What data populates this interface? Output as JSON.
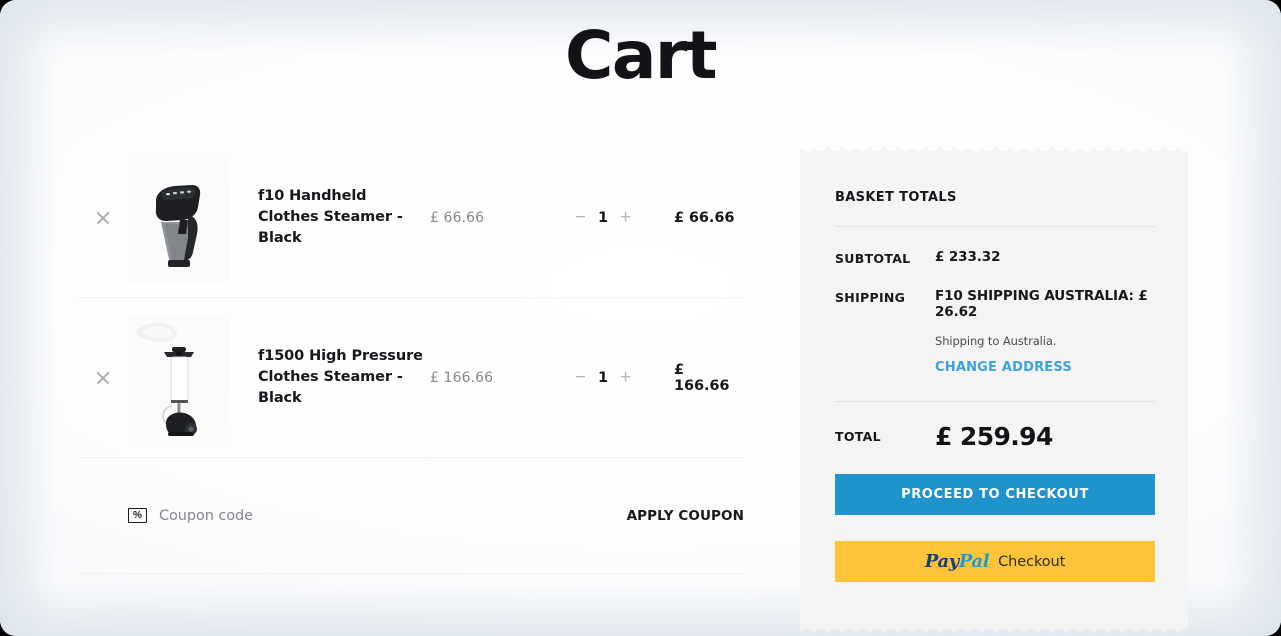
{
  "page": {
    "title": "Cart"
  },
  "cart": {
    "items": [
      {
        "remove_label": "×",
        "name": "f10 Handheld Clothes Steamer - Black",
        "price": "£ 66.66",
        "qty_minus": "−",
        "qty": "1",
        "qty_plus": "+",
        "subtotal": "£ 66.66",
        "image_alt": "handheld-clothes-steamer-black"
      },
      {
        "remove_label": "×",
        "name": "f1500 High Pressure Clothes Steamer - Black",
        "price": "£ 166.66",
        "qty_minus": "−",
        "qty": "1",
        "qty_plus": "+",
        "subtotal": "£ 166.66",
        "image_alt": "standing-garment-steamer-black"
      }
    ],
    "coupon": {
      "icon": "percent-box-icon",
      "icon_glyph": "%",
      "placeholder": "Coupon code",
      "value": "",
      "apply_label": "APPLY COUPON"
    }
  },
  "totals": {
    "heading": "BASKET TOTALS",
    "subtotal_label": "SUBTOTAL",
    "subtotal_value": "£ 233.32",
    "shipping_label": "SHIPPING",
    "shipping_value": "F10 SHIPPING AUSTRALIA: £ 26.62",
    "shipping_note": "Shipping to Australia.",
    "change_address_label": "CHANGE ADDRESS",
    "total_label": "TOTAL",
    "total_value": "£ 259.94",
    "checkout_label": "PROCEED TO CHECKOUT",
    "paypal": {
      "pay": "Pay",
      "pal": "Pal",
      "word": "Checkout"
    }
  },
  "colors": {
    "accent_blue": "#1f93cc",
    "link_blue": "#3da2dc",
    "paypal_yellow": "#fdc43a",
    "paypal_navy": "#153f7d",
    "paypal_cyan": "#1b9ad6",
    "panel_bg": "#f4f4f5",
    "text_dark": "#16181c",
    "text_muted": "#85878c"
  }
}
